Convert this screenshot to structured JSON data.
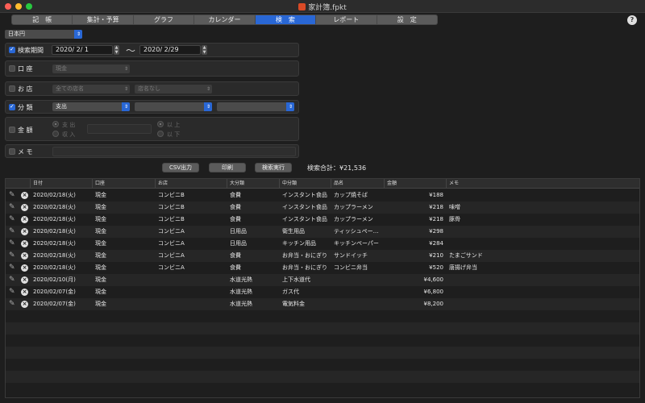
{
  "window": {
    "title": "家計簿.fpkt"
  },
  "tabs": [
    "記　帳",
    "集計・予算",
    "グラフ",
    "カレンダー",
    "検　索",
    "レポート",
    "設　定"
  ],
  "active_tab": 4,
  "help_label": "?",
  "currency": {
    "value": "日本円"
  },
  "filters": {
    "period": {
      "label": "検索期間",
      "checked": true,
      "start": "2020/  2/  1",
      "end": "2020/  2/29",
      "separator": "〜"
    },
    "account": {
      "label": "口 座",
      "checked": false,
      "value": "現金"
    },
    "shop": {
      "label": "お 店",
      "checked": false,
      "value1": "全ての店名",
      "value2": "店名なし"
    },
    "category": {
      "label": "分 類",
      "checked": true,
      "value1": "支出",
      "value2": "",
      "value3": ""
    },
    "amount": {
      "label": "金 額",
      "checked": false,
      "type1": "支 出",
      "type2": "収 入",
      "cmp1": "以 上",
      "cmp2": "以 下"
    },
    "memo": {
      "label": "メ モ",
      "checked": false
    }
  },
  "actions": {
    "csv": "CSV出力",
    "print": "印刷",
    "search": "検索実行",
    "total_label": "検索合計：",
    "total_value": "¥21,536"
  },
  "table": {
    "headers": {
      "date": "日付",
      "account": "口座",
      "shop": "お店",
      "major": "大分類",
      "minor": "中分類",
      "item": "品名",
      "amount": "金額",
      "memo": "メモ"
    },
    "rows": [
      {
        "date": "2020/02/18(火)",
        "account": "現金",
        "shop": "コンビニB",
        "major": "食費",
        "minor": "インスタント食品",
        "item": "カップ焼そば",
        "amount": "¥188",
        "memo": ""
      },
      {
        "date": "2020/02/18(火)",
        "account": "現金",
        "shop": "コンビニB",
        "major": "食費",
        "minor": "インスタント食品",
        "item": "カップラーメン",
        "amount": "¥218",
        "memo": "味噌"
      },
      {
        "date": "2020/02/18(火)",
        "account": "現金",
        "shop": "コンビニB",
        "major": "食費",
        "minor": "インスタント食品",
        "item": "カップラーメン",
        "amount": "¥218",
        "memo": "豚骨"
      },
      {
        "date": "2020/02/18(火)",
        "account": "現金",
        "shop": "コンビニA",
        "major": "日用品",
        "minor": "衛生用品",
        "item": "ティッシュペー…",
        "amount": "¥298",
        "memo": ""
      },
      {
        "date": "2020/02/18(火)",
        "account": "現金",
        "shop": "コンビニA",
        "major": "日用品",
        "minor": "キッチン用品",
        "item": "キッチンペーパー",
        "amount": "¥284",
        "memo": ""
      },
      {
        "date": "2020/02/18(火)",
        "account": "現金",
        "shop": "コンビニA",
        "major": "食費",
        "minor": "お弁当・おにぎり",
        "item": "サンドイッチ",
        "amount": "¥210",
        "memo": "たまごサンド"
      },
      {
        "date": "2020/02/18(火)",
        "account": "現金",
        "shop": "コンビニA",
        "major": "食費",
        "minor": "お弁当・おにぎり",
        "item": "コンビニ弁当",
        "amount": "¥520",
        "memo": "唐揚げ弁当"
      },
      {
        "date": "2020/02/10(月)",
        "account": "現金",
        "shop": "",
        "major": "水道光熱",
        "minor": "上下水道代",
        "item": "",
        "amount": "¥4,600",
        "memo": ""
      },
      {
        "date": "2020/02/07(金)",
        "account": "現金",
        "shop": "",
        "major": "水道光熱",
        "minor": "ガス代",
        "item": "",
        "amount": "¥6,800",
        "memo": ""
      },
      {
        "date": "2020/02/07(金)",
        "account": "現金",
        "shop": "",
        "major": "水道光熱",
        "minor": "電気料金",
        "item": "",
        "amount": "¥8,200",
        "memo": ""
      }
    ]
  },
  "colors": {
    "accent": "#2967d5",
    "background": "#1e1e1e",
    "panel": "#2a2a2a"
  },
  "icons": [
    "edit-pencil-icon",
    "delete-x-icon",
    "help-icon",
    "checkbox-icon",
    "stepper-icon",
    "dropdown-arrow-icon"
  ]
}
